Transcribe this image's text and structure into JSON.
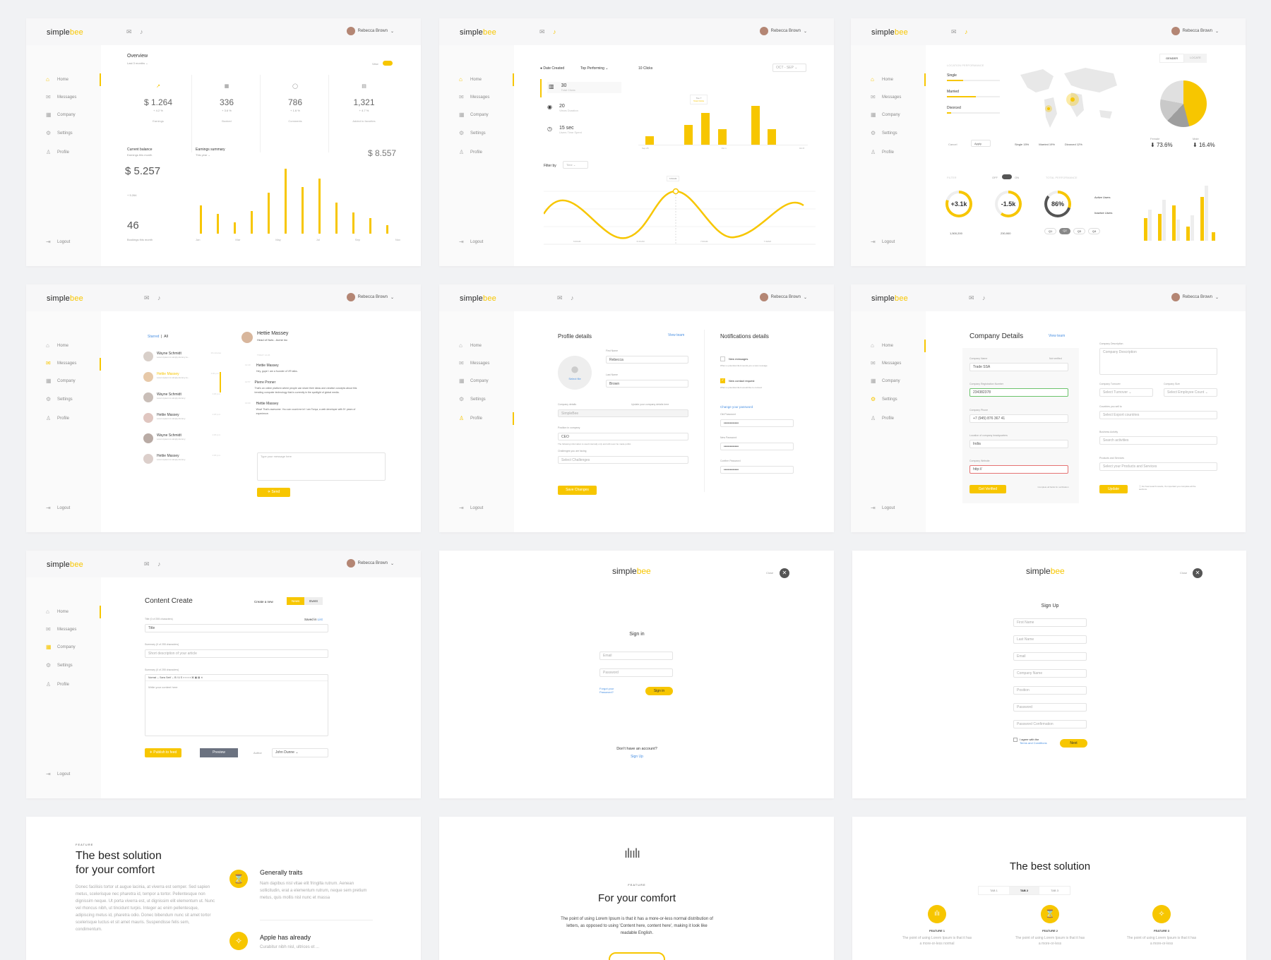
{
  "brand": {
    "simple": "simple",
    "bee": "bee"
  },
  "user": "Rebecca Brown",
  "nav": {
    "home": "Home",
    "messages": "Messages",
    "company": "Company",
    "settings": "Settings",
    "profile": "Profile",
    "logout": "Logout"
  },
  "overview": {
    "title": "Overview",
    "period": "Last 3 months ⌄",
    "view": "View",
    "stats": [
      {
        "value": "$ 1.264",
        "change": "+ 4.2 %",
        "label": "Earnings"
      },
      {
        "value": "336",
        "change": "+ 3.6 %",
        "label": "Booked"
      },
      {
        "value": "786",
        "change": "+ 1.6 %",
        "label": "Comments"
      },
      {
        "value": "1,321",
        "change": "+ 4.7 %",
        "label": "Added to favorites"
      }
    ],
    "balance_title": "Current balance",
    "balance_sub": "Earnings this month",
    "balance": "$ 5.257",
    "balance_change": "+ 5.264",
    "count": "46",
    "count_label": "Bookings this month",
    "summary_title": "Earnings summary",
    "summary_period": "This year ⌄",
    "summary_value": "$ 8.557",
    "months": [
      "Jan",
      "Mar",
      "May",
      "Jul",
      "Sep",
      "Nov"
    ]
  },
  "clicks": {
    "date_created": "Date Created",
    "top_performing": "Top Performing ⌄",
    "clicks_label": "10 Clicks",
    "range": "OCT - SEP ⌄",
    "metrics": [
      {
        "value": "30",
        "label": "Total Clicks"
      },
      {
        "value": "20",
        "label": "Views Duration"
      },
      {
        "value": "15 sec",
        "label": "Users Time Spent"
      }
    ],
    "tooltip": "Total Clicks",
    "tooltip_val": "Tue 7",
    "filter": "Filter by",
    "filter_val": "Time ⌄",
    "wave_tip": "6:50AM",
    "times": [
      "6:00AM",
      "6:30 AM",
      "7:00AM",
      "7:30AM"
    ],
    "axis": [
      "Sep 25",
      "Oct 1",
      "Oct 8"
    ]
  },
  "geo": {
    "title": "LOCATION PERFORMANCE",
    "tabs": [
      "GENDER",
      "LOCATE"
    ],
    "sliders": [
      "Single",
      "Married",
      "Divorced"
    ],
    "cancel": "Cancel",
    "apply": "Apply",
    "legend": [
      "Single 15%",
      "Married 19%",
      "Divorced 12%"
    ],
    "female": "Female",
    "female_val": "73.6%",
    "male": "Male",
    "male_val": "16.4%",
    "filter": "FILTER",
    "off": "OFF",
    "on": "ON",
    "total": "TOTAL PERFORMANCE",
    "rings": [
      {
        "value": "+3.1k",
        "label": "Active Users",
        "sub": "1,500,200"
      },
      {
        "value": "-1.5k",
        "label": "Inactive Users",
        "sub": "230,900"
      },
      {
        "value": "86%",
        "label": "",
        "sub": ""
      }
    ],
    "active": "Active Users",
    "inactive": "Inactive Users",
    "quarters": [
      "Q1",
      "Q2",
      "Q3",
      "Q4"
    ]
  },
  "messages": {
    "starred": "Starred",
    "all": "All",
    "list": [
      {
        "name": "Wayne Schmidt",
        "text": "Lorem Ipsum is simply dummy te...",
        "time": "16 minutes"
      },
      {
        "name": "Hettie Massey",
        "text": "Lorem Ipsum is simply dummy te...",
        "time": "1:20 p.m."
      },
      {
        "name": "Wayne Schmidt",
        "text": "Lorem Ipsum is simply dummy",
        "time": "1:20 p.m."
      },
      {
        "name": "Hettie Massey",
        "text": "Lorem Ipsum is simply dummy",
        "time": "1:20 p.m."
      },
      {
        "name": "Wayne Schmidt",
        "text": "Lorem Ipsum is simply dummy",
        "time": "1:20 p.m."
      },
      {
        "name": "Hettie Massey",
        "text": "Lorem Ipsum is simply dummy",
        "time": "1:20 p.m."
      }
    ],
    "chat_name": "Hettie Massey",
    "chat_role": "Head of Nuts - Acme inc",
    "today": "TODAY 12:26",
    "thread": [
      {
        "time": "12:40",
        "name": "Hettie Massey",
        "text": "Hey, guys! I am a founder of VR talks."
      },
      {
        "time": "12:57",
        "name": "Pierre Proner",
        "text": "That's an online platform where people can share their ideas and creative concepts about this trending computer technology that is currently in the spotlight of global media."
      },
      {
        "time": "13:00",
        "name": "Hettie Massey",
        "text": "Wow! That's awesome. You can count me in! I am Tonya, a web developer with 5+ years of experience."
      }
    ],
    "placeholder": "Type your message here",
    "send": "Send"
  },
  "profile": {
    "title": "Profile details",
    "view_team": "View team",
    "select_file": "Select file",
    "first_label": "First Name",
    "first": "Rebecca",
    "last_label": "Last Name",
    "last": "Brown",
    "company_label": "Company details",
    "company_hint": "Update your company details here",
    "company": "SimpleBee",
    "position_label": "Position in company",
    "position": "CEO",
    "note": "The following information is used internally only and will never be made public.",
    "challenges_label": "Challenges you are facing",
    "challenges": "Select Challenges",
    "save": "Save Changes",
    "notif_title": "Notifications details",
    "n1": "New messages",
    "n1_sub": "When a potential client sends you a new message",
    "n2": "New contact request",
    "n2_sub": "When a potential client would like to connect",
    "change_pw": "Change your password",
    "old": "Old Password",
    "new": "New Password",
    "confirm": "Confirm Password",
    "dots": "••••••••••••"
  },
  "company": {
    "title": "Company Details",
    "view_team": "View team",
    "name_label": "Company Name",
    "verified": "Not verified",
    "name": "Trade SSA",
    "reg_label": "Company Registration Number",
    "reg": "234382378",
    "phone_label": "Company Phone",
    "phone": "+7 (945) 876 367 41",
    "loc_label": "Location of company headquarters",
    "loc": "India",
    "web_label": "Company Website",
    "web": "http://",
    "get_verified": "Get Verified",
    "verify_note": "Complete all fields for verification",
    "desc_label": "Company Description",
    "desc": "Company Description",
    "turnover_label": "Company Turnover",
    "turnover": "Select Turnover ⌄",
    "size_label": "Company Size",
    "size": "Select Employee Count ⌄",
    "sell_label": "Countries you sell to",
    "sell": "Select Export countries",
    "activity_label": "Business Activity",
    "activity": "Search activities",
    "products_label": "Products and Services",
    "products": "Select your Products and Services",
    "update": "Update",
    "update_note": "For best search results, it's important you complete all the sections."
  },
  "content": {
    "title": "Content Create",
    "create_new": "Create a new",
    "tabs": [
      "News",
      "Event"
    ],
    "title_label": "Title (0 of 255 characters)",
    "saved": "Saved in",
    "saved_link": "List",
    "title_ph": "Title",
    "summary_label": "Summary (0 of 255 characters)",
    "summary_ph": "Short description of your article",
    "body_label": "Summary (0 of 255 characters)",
    "toolbar": "Normal  ⌄   Sans Serif ⌄   B  I  U  S  ≡  ≡  ≡  ≡   ⌘  ▣  ▤   ✕",
    "body_ph": "Write your content here",
    "publish": "Publish to feed",
    "preview": "Preview",
    "author": "Author",
    "author_val": "John Dunne ⌄"
  },
  "signin": {
    "close": "Close",
    "title": "Sign in",
    "email": "Email",
    "password": "Password",
    "forgot": "Forgot your Password?",
    "btn": "Sign in",
    "no_account": "Don't have an account?",
    "signup": "Sign Up"
  },
  "signup": {
    "close": "Close",
    "title": "Sign Up",
    "fields": [
      "First Name",
      "Last Name",
      "Email",
      "Company Name",
      "Position",
      "Password",
      "Password Confirmation"
    ],
    "agree": "I agree with the",
    "terms": "Terms and Conditions",
    "next": "Next"
  },
  "feature1": {
    "eyebrow": "FEATURE",
    "title1": "The best solution",
    "title2": "for your comfort",
    "body": "Donec facilisis tortor ut augue lacinia, at viverra est semper. Sed sapien metus, scelerisque nec pharetra id, tempor a tortor. Pellentesque non dignissim neque. Ut porta viverra est, ut dignissim elit elementum ut. Nunc vel rhoncus nibh, ut tincidunt turpis. Integer ac enim pellentesque, adipiscing metus id, pharetra odio. Donec bibendum nunc sit amet tortor scelerisque luctus et sit amet mauris. Suspendisse felis sem, condimentum.",
    "f1": "Generally traits",
    "f1_body": "Nam dapibus nisl vitae elit fringilla rutrum. Aenean sollicitudin, erat a elementum rutrum, neque sem pretium metus, quis mollis nisl nunc et massa",
    "f2": "Apple has already",
    "f2_body": "Curabitur nibh nisl, ultrices et ..."
  },
  "feature2": {
    "eyebrow": "FEATURE",
    "title": "For your comfort",
    "body": "The point of using Lorem Ipsum is that it has a more-or-less normal distribution of letters, as opposed to using 'Content here, content here', making it look like readable English."
  },
  "feature3": {
    "title": "The best solution",
    "tabs": [
      "TAB 1",
      "TAB 2",
      "TAB 3"
    ],
    "features": [
      {
        "name": "FEATURE 1",
        "text": "The point of using Lorem Ipsum is that it has a more-or-less normal"
      },
      {
        "name": "FEATURE 2",
        "text": "The point of using Lorem Ipsum is that it has a more-or-less"
      },
      {
        "name": "FEATURE 3",
        "text": "The point of using Lorem Ipsum is that it has a more-or-less"
      }
    ]
  }
}
